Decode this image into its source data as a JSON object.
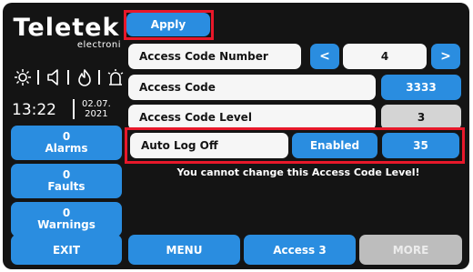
{
  "brand": {
    "name": "Teletek",
    "sub": "electroni"
  },
  "status_icons": [
    "sun-icon",
    "speaker-icon",
    "flame-icon",
    "siren-icon"
  ],
  "clock": {
    "time": "13:22",
    "date_line1": "02.07.",
    "date_line2": "2021"
  },
  "side_buttons": {
    "alarms": {
      "count": "0",
      "label": "Alarms"
    },
    "faults": {
      "count": "0",
      "label": "Faults"
    },
    "warnings": {
      "count": "0",
      "label": "Warnings"
    }
  },
  "apply_label": "Apply",
  "fields": {
    "access_code_number": {
      "label": "Access Code Number",
      "value": "4",
      "prev": "<",
      "next": ">"
    },
    "access_code": {
      "label": "Access Code",
      "value": "3333"
    },
    "access_code_level": {
      "label": "Access Code Level",
      "value": "3"
    },
    "auto_log_off": {
      "label": "Auto Log Off",
      "state": "Enabled",
      "value": "35"
    }
  },
  "message": "You cannot change this Access Code Level!",
  "bottom_bar": {
    "exit": "EXIT",
    "menu": "MENU",
    "access": "Access 3",
    "more": "MORE"
  },
  "colors": {
    "accent": "#2a8de0",
    "highlight": "#e8182a",
    "background": "#141414",
    "disabled": "#bdbdbd"
  }
}
